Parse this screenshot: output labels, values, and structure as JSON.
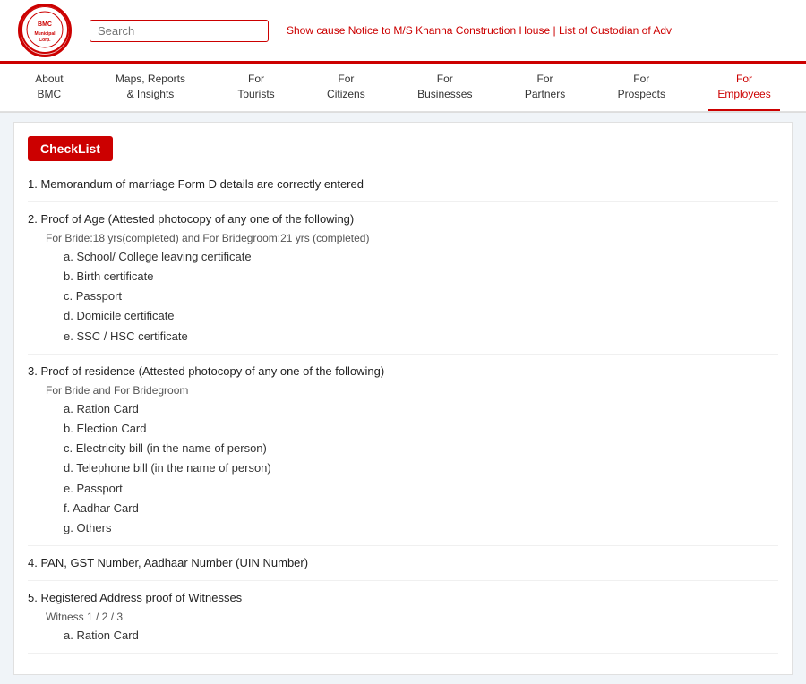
{
  "header": {
    "search_placeholder": "Search",
    "marquee_text": "Show cause Notice to M/S Khanna Construction House | List of Custodian of Adv",
    "logo_text": "BMC"
  },
  "nav": {
    "items": [
      {
        "id": "about",
        "label": "About\nBMC"
      },
      {
        "id": "maps",
        "label": "Maps, Reports\n& Insights"
      },
      {
        "id": "tourists",
        "label": "For\nTourists"
      },
      {
        "id": "citizens",
        "label": "For\nCitizens"
      },
      {
        "id": "businesses",
        "label": "For\nBusinesses"
      },
      {
        "id": "partners",
        "label": "For\nPartners"
      },
      {
        "id": "prospects",
        "label": "For\nProspects"
      },
      {
        "id": "employees",
        "label": "For\nEmployees",
        "active": true
      }
    ]
  },
  "content": {
    "checklist_label": "CheckList",
    "items": [
      {
        "number": "1.",
        "title": "Memorandum of marriage Form D details are correctly entered",
        "subnote": null,
        "sublist": []
      },
      {
        "number": "2.",
        "title": "Proof of Age (Attested photocopy of any one of the following)",
        "subnote": "For Bride:18 yrs(completed) and For Bridegroom:21 yrs (completed)",
        "sublist": [
          "a. School/ College leaving certificate",
          "b. Birth certificate",
          "c. Passport",
          "d. Domicile certificate",
          "e. SSC / HSC certificate"
        ]
      },
      {
        "number": "3.",
        "title": "Proof of residence (Attested photocopy of any one of the following)",
        "subnote": "For Bride and For Bridegroom",
        "sublist": [
          "a. Ration Card",
          "b. Election Card",
          "c. Electricity bill (in the name of person)",
          "d. Telephone bill (in the name of person)",
          "e. Passport",
          "f. Aadhar Card",
          "g. Others"
        ]
      },
      {
        "number": "4.",
        "title": "PAN, GST Number, Aadhaar Number (UIN Number)",
        "subnote": null,
        "sublist": []
      },
      {
        "number": "5.",
        "title": "Registered Address proof of Witnesses",
        "subnote": "Witness 1 / 2 / 3",
        "sublist": [
          "a. Ration Card"
        ]
      }
    ]
  }
}
